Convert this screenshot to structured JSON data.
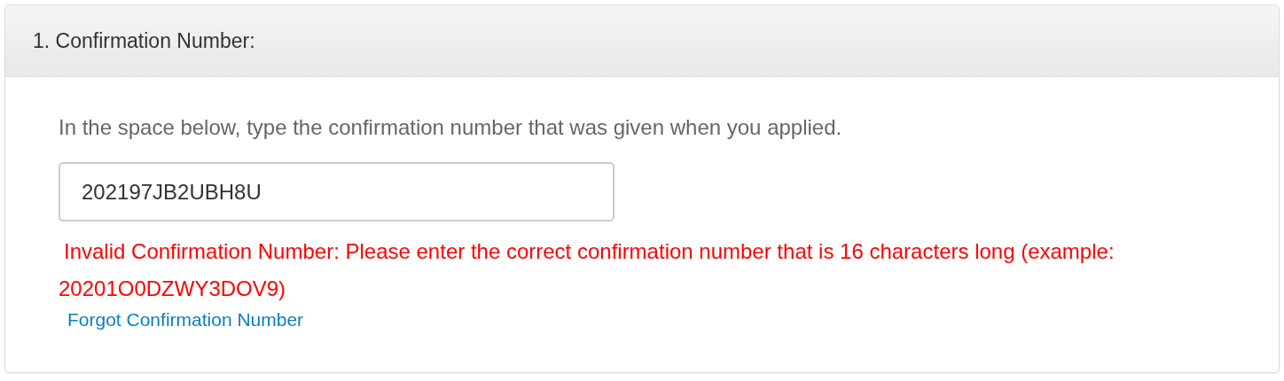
{
  "panel": {
    "title": "1. Confirmation Number:"
  },
  "instruction": "In the space below, type the confirmation number that was given when you applied.",
  "confirmation_field": {
    "value": "202197JB2UBH8U"
  },
  "error": "Invalid Confirmation Number: Please enter the correct confirmation number that is 16 characters long (example: 20201O0DZWY3DOV9)",
  "link": "Forgot Confirmation Number"
}
